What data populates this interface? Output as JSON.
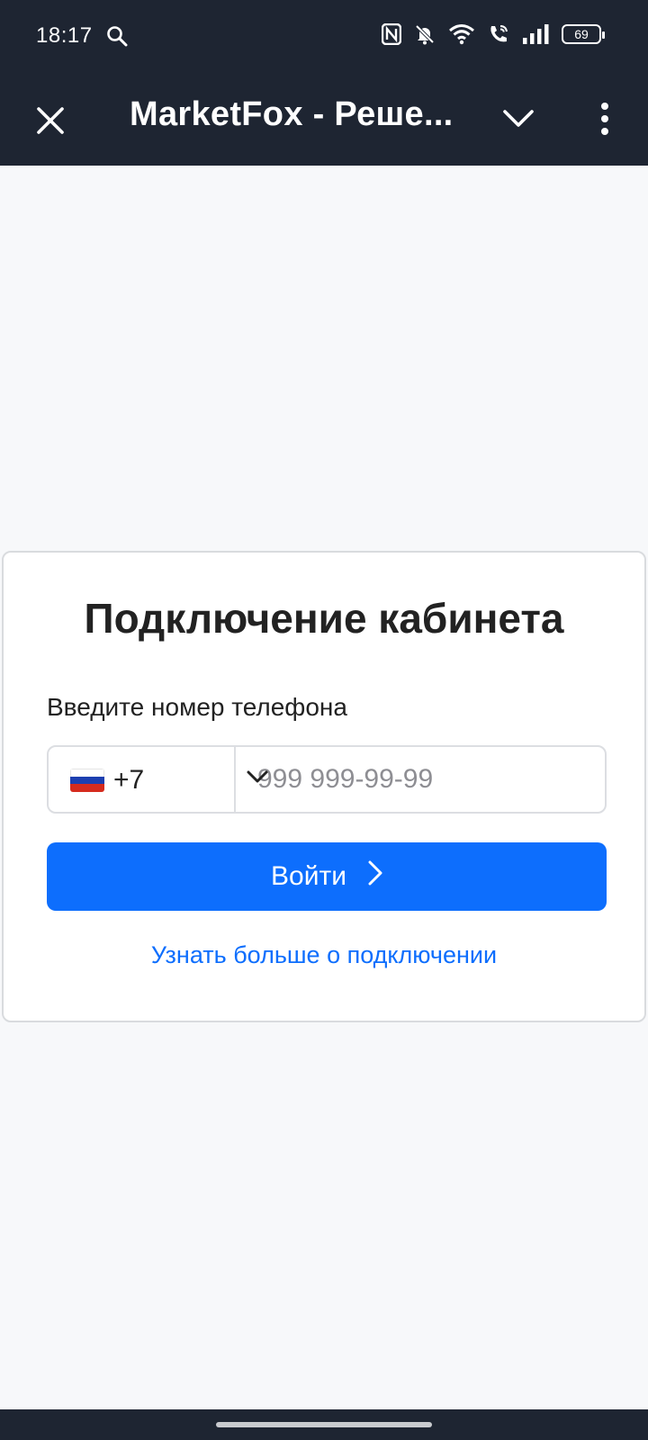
{
  "status_bar": {
    "time": "18:17",
    "battery": "69",
    "icons": [
      "search-icon",
      "nfc-icon",
      "mute-icon",
      "wifi-icon",
      "wifi-call-icon",
      "signal-icon",
      "battery-icon"
    ]
  },
  "app_bar": {
    "title": "MarketFox - Реше...",
    "close_icon": "close-icon",
    "expand_icon": "chevron-down-icon",
    "menu_icon": "more-vert-icon"
  },
  "card": {
    "title": "Подключение кабинета",
    "phone_label": "Введите номер телефона",
    "country_code": "+7",
    "country_flag": "russia-flag-icon",
    "phone_placeholder": "999 999-99-99",
    "phone_value": "",
    "login_button": "Войти",
    "more_link": "Узнать больше о подключении"
  },
  "colors": {
    "header_bg": "#1e2532",
    "page_bg": "#f7f8fa",
    "primary": "#0d6efd",
    "text": "#222222"
  }
}
